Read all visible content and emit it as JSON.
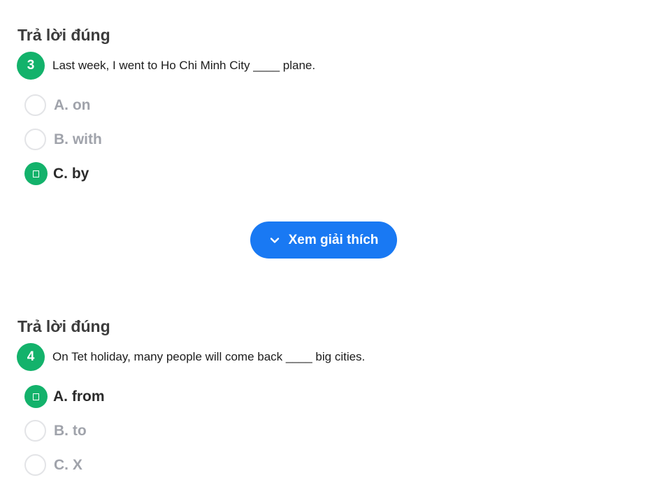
{
  "colors": {
    "accent_green": "#13b26b",
    "button_blue": "#1979f3",
    "muted_text": "#a0a3ab",
    "radio_border": "#e3e4e7"
  },
  "questions": [
    {
      "result_title": "Trả lời đúng",
      "number": "3",
      "text": "Last week, I went to Ho Chi Minh City ____ plane.",
      "options": [
        {
          "label": "A. on",
          "selected": false,
          "icon": ""
        },
        {
          "label": "B. with",
          "selected": false,
          "icon": ""
        },
        {
          "label": "C. by",
          "selected": true,
          "icon": "check-icon"
        }
      ],
      "explain_button": {
        "label": "Xem giải thích",
        "icon": "chevron-down-icon"
      }
    },
    {
      "result_title": "Trả lời đúng",
      "number": "4",
      "text": "On Tet holiday, many people will come back ____ big cities.",
      "options": [
        {
          "label": "A. from",
          "selected": true,
          "icon": "check-icon"
        },
        {
          "label": "B. to",
          "selected": false,
          "icon": ""
        },
        {
          "label": "C. X",
          "selected": false,
          "icon": ""
        }
      ]
    }
  ]
}
